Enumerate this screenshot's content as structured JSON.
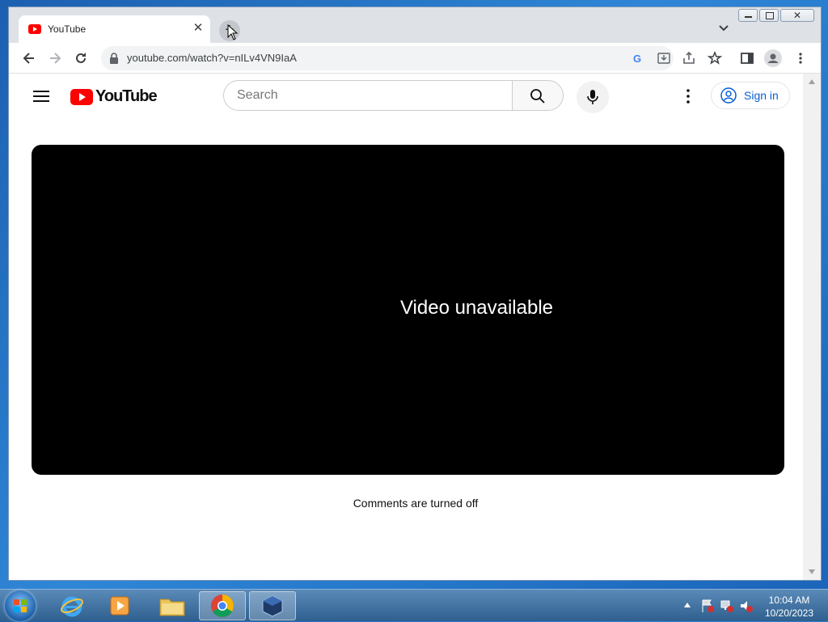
{
  "browser": {
    "tab_title": "YouTube",
    "url": "youtube.com/watch?v=nILv4VN9IaA"
  },
  "youtube": {
    "logo_text": "YouTube",
    "search_placeholder": "Search",
    "sign_in_label": "Sign in",
    "player_message": "Video unavailable",
    "comments_status": "Comments are turned off",
    "brand_color": "#ff0000",
    "link_color": "#065fd4"
  },
  "taskbar": {
    "time": "10:04 AM",
    "date": "10/20/2023",
    "apps": [
      "internet-explorer",
      "media-player",
      "file-explorer",
      "chrome",
      "virtualbox"
    ]
  }
}
